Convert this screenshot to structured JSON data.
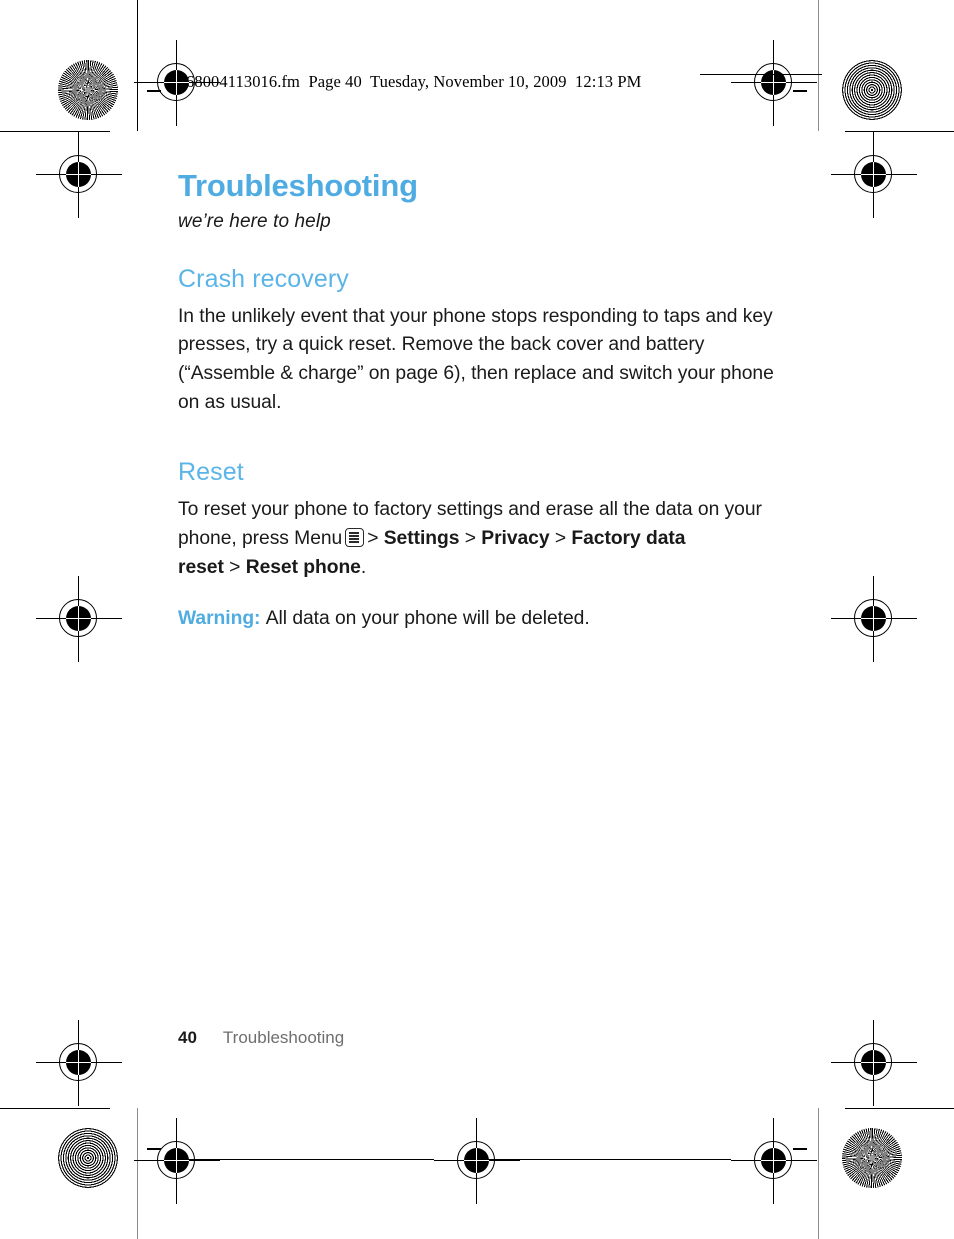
{
  "header": {
    "fm_line": "68004113016.fm  Page 40  Tuesday, November 10, 2009  12:13 PM"
  },
  "content": {
    "chapter_title": "Troubleshooting",
    "chapter_subtitle": "we’re here to help",
    "sections": [
      {
        "heading": "Crash recovery",
        "paragraph": "In the unlikely event that your phone stops responding to taps and key presses, try a quick reset. Remove the back cover and battery (“Assemble & charge” on page 6), then replace and switch your phone on as usual."
      },
      {
        "heading": "Reset",
        "reset_intro": "To reset your phone to factory settings and erase all the data on your phone, press Menu",
        "path": {
          "sep1": ">",
          "item1": "Settings",
          "sep2": ">",
          "item2": "Privacy",
          "sep3": ">",
          "item3": "Factory data reset",
          "sep4": ">",
          "item4": "Reset phone",
          "period": "."
        },
        "warning_label": "Warning:",
        "warning_text": "All data on your phone will be deleted."
      }
    ]
  },
  "footer": {
    "page_number": "40",
    "chapter_name": "Troubleshooting"
  },
  "colors": {
    "accent_blue": "#4FACE2",
    "heading_blue": "#5BB4E8",
    "body_black": "#1a1a1a",
    "footer_gray": "#6e6e6e"
  },
  "marks": {
    "menu_icon": "menu-key-icon",
    "targets": [
      "starburst-target",
      "moire-target",
      "registration-crosshair"
    ]
  }
}
